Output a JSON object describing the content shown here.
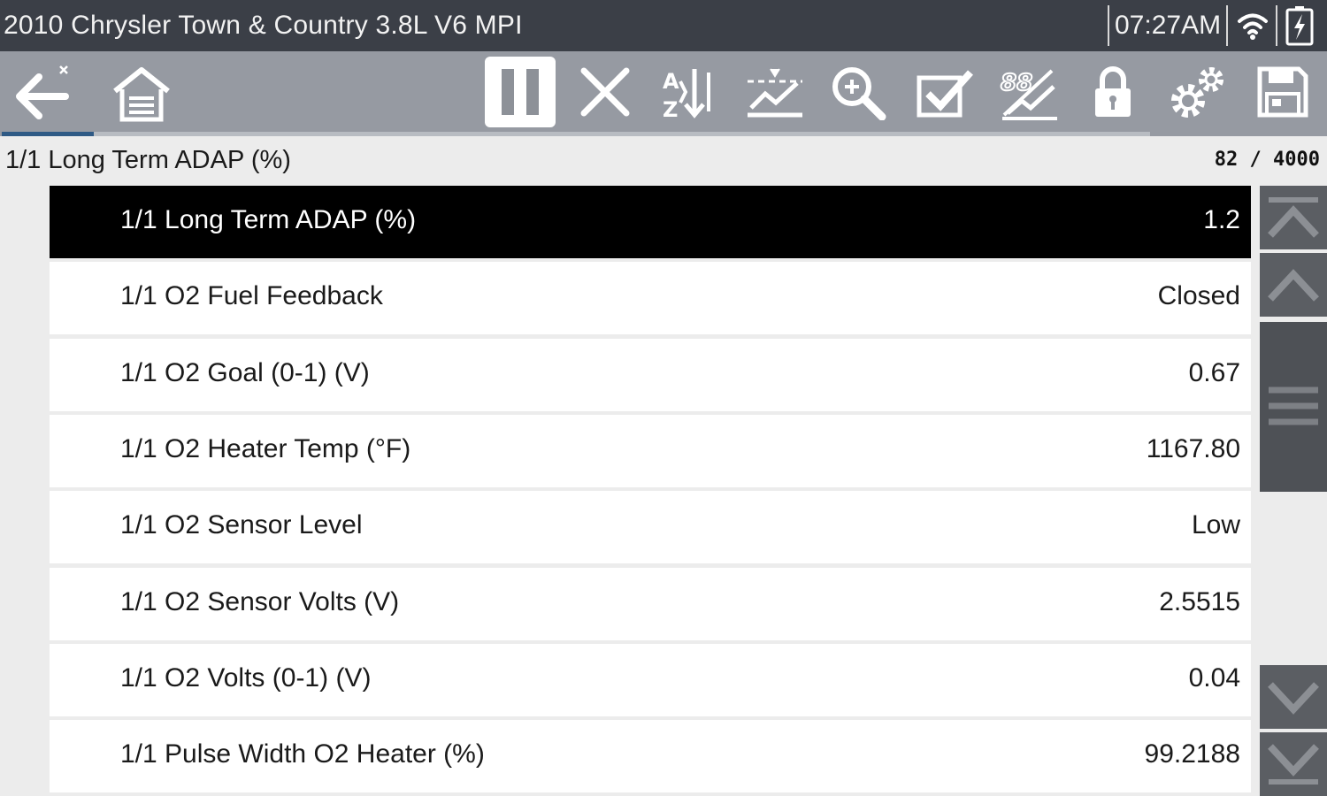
{
  "status_bar": {
    "vehicle_title": "2010 Chrysler Town & Country 3.8L V6 MPI",
    "time": "07:27AM"
  },
  "toolbar": {
    "buttons": [
      {
        "name": "back-button",
        "icon": "back-arrow-icon"
      },
      {
        "name": "home-button",
        "icon": "home-icon"
      },
      {
        "name": "pause-button",
        "icon": "pause-icon",
        "active": true
      },
      {
        "name": "clear-button",
        "icon": "close-icon"
      },
      {
        "name": "sort-button",
        "icon": "sort-az-icon"
      },
      {
        "name": "trigger-button",
        "icon": "trigger-graph-icon"
      },
      {
        "name": "zoom-button",
        "icon": "zoom-icon"
      },
      {
        "name": "select-button",
        "icon": "checkmark-icon"
      },
      {
        "name": "view-button",
        "icon": "view-graph-icon"
      },
      {
        "name": "lock-button",
        "icon": "lock-icon"
      },
      {
        "name": "settings-button",
        "icon": "gear-icon"
      },
      {
        "name": "save-button",
        "icon": "save-icon"
      }
    ],
    "buffer_progress": 0.08
  },
  "header": {
    "title": "1/1 Long Term ADAP (%)",
    "frame_count": "82 / 4000"
  },
  "pid_list": [
    {
      "label": "1/1 Long Term ADAP (%)",
      "value": "1.2",
      "selected": true
    },
    {
      "label": "1/1 O2 Fuel Feedback",
      "value": "Closed"
    },
    {
      "label": "1/1 O2 Goal (0-1) (V)",
      "value": "0.67"
    },
    {
      "label": "1/1 O2 Heater Temp (°F)",
      "value": "1167.80"
    },
    {
      "label": "1/1 O2 Sensor Level",
      "value": "Low"
    },
    {
      "label": "1/1 O2 Sensor Volts (V)",
      "value": "2.5515"
    },
    {
      "label": "1/1 O2 Volts (0-1) (V)",
      "value": "0.04"
    },
    {
      "label": "1/1 Pulse Width O2 Heater (%)",
      "value": "99.2188"
    }
  ],
  "colors": {
    "title_bar": "#3b3f47",
    "toolbar": "#969aa2",
    "selected_row": "#000000",
    "progress": "#2f5a85"
  }
}
